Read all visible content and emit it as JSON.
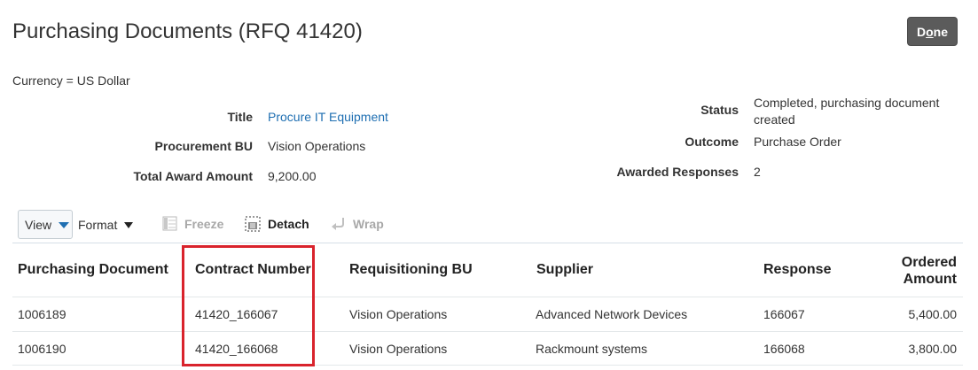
{
  "header": {
    "title": "Purchasing Documents (RFQ 41420)",
    "done_prefix": "D",
    "done_underlined": "o",
    "done_suffix": "ne"
  },
  "currency": "Currency = US Dollar",
  "summary": {
    "left": [
      {
        "label": "Title",
        "value": "Procure IT Equipment",
        "is_link": true
      },
      {
        "label": "Procurement BU",
        "value": "Vision Operations",
        "is_link": false
      },
      {
        "label": "Total Award Amount",
        "value": "9,200.00",
        "is_link": false
      }
    ],
    "right": [
      {
        "label": "Status",
        "value_line1": "Completed, purchasing document",
        "value_line2": "created"
      },
      {
        "label": "Outcome",
        "value_line1": "Purchase Order"
      },
      {
        "label": "Awarded Responses",
        "value_line1": "2"
      }
    ]
  },
  "toolbar": {
    "view": "View",
    "format": "Format",
    "freeze": "Freeze",
    "detach": "Detach",
    "wrap": "Wrap"
  },
  "table": {
    "columns": {
      "purchasing_document": "Purchasing Document",
      "contract_number": "Contract Number",
      "requisitioning_bu": "Requisitioning BU",
      "supplier": "Supplier",
      "response": "Response",
      "ordered_amount_line1": "Ordered",
      "ordered_amount_line2": "Amount"
    },
    "rows": [
      {
        "purchasing_document": "1006189",
        "contract_number": "41420_166067",
        "requisitioning_bu": "Vision Operations",
        "supplier": "Advanced Network Devices",
        "response": "166067",
        "ordered_amount": "5,400.00"
      },
      {
        "purchasing_document": "1006190",
        "contract_number": "41420_166068",
        "requisitioning_bu": "Vision Operations",
        "supplier": "Rackmount systems",
        "response": "166068",
        "ordered_amount": "3,800.00"
      }
    ]
  },
  "colors": {
    "link": "#1f6fb2",
    "highlight": "#d9232c",
    "done_button": "#5b5b5b"
  }
}
